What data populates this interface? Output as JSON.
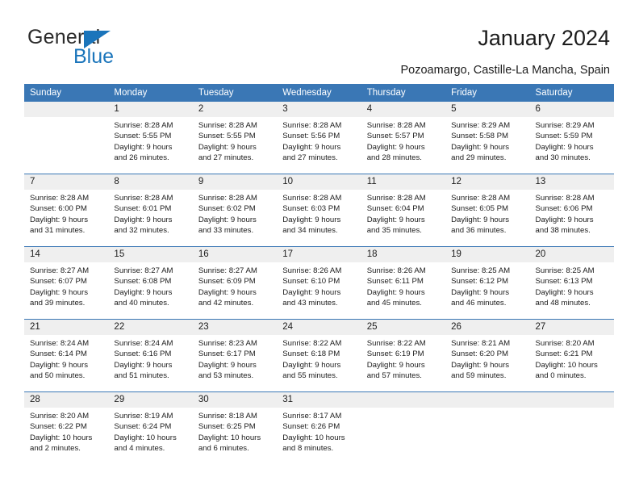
{
  "brand": {
    "name_part1": "General",
    "name_part2": "Blue"
  },
  "header": {
    "title": "January 2024",
    "subtitle": "Pozoamargo, Castille-La Mancha, Spain"
  },
  "colors": {
    "header_blue": "#3a77b5",
    "brand_blue": "#1b75bb",
    "daynum_bg": "#efefef",
    "text": "#1c1c1c"
  },
  "weekdays": [
    "Sunday",
    "Monday",
    "Tuesday",
    "Wednesday",
    "Thursday",
    "Friday",
    "Saturday"
  ],
  "labels": {
    "sunrise_prefix": "Sunrise:",
    "sunset_prefix": "Sunset:",
    "daylight_prefix": "Daylight:"
  },
  "weeks": [
    [
      {
        "day": "",
        "blank": true,
        "line1": "",
        "line2": "",
        "line3": "",
        "line4": ""
      },
      {
        "day": "1",
        "line1": "Sunrise: 8:28 AM",
        "line2": "Sunset: 5:55 PM",
        "line3": "Daylight: 9 hours",
        "line4": "and 26 minutes."
      },
      {
        "day": "2",
        "line1": "Sunrise: 8:28 AM",
        "line2": "Sunset: 5:55 PM",
        "line3": "Daylight: 9 hours",
        "line4": "and 27 minutes."
      },
      {
        "day": "3",
        "line1": "Sunrise: 8:28 AM",
        "line2": "Sunset: 5:56 PM",
        "line3": "Daylight: 9 hours",
        "line4": "and 27 minutes."
      },
      {
        "day": "4",
        "line1": "Sunrise: 8:28 AM",
        "line2": "Sunset: 5:57 PM",
        "line3": "Daylight: 9 hours",
        "line4": "and 28 minutes."
      },
      {
        "day": "5",
        "line1": "Sunrise: 8:29 AM",
        "line2": "Sunset: 5:58 PM",
        "line3": "Daylight: 9 hours",
        "line4": "and 29 minutes."
      },
      {
        "day": "6",
        "line1": "Sunrise: 8:29 AM",
        "line2": "Sunset: 5:59 PM",
        "line3": "Daylight: 9 hours",
        "line4": "and 30 minutes."
      }
    ],
    [
      {
        "day": "7",
        "line1": "Sunrise: 8:28 AM",
        "line2": "Sunset: 6:00 PM",
        "line3": "Daylight: 9 hours",
        "line4": "and 31 minutes."
      },
      {
        "day": "8",
        "line1": "Sunrise: 8:28 AM",
        "line2": "Sunset: 6:01 PM",
        "line3": "Daylight: 9 hours",
        "line4": "and 32 minutes."
      },
      {
        "day": "9",
        "line1": "Sunrise: 8:28 AM",
        "line2": "Sunset: 6:02 PM",
        "line3": "Daylight: 9 hours",
        "line4": "and 33 minutes."
      },
      {
        "day": "10",
        "line1": "Sunrise: 8:28 AM",
        "line2": "Sunset: 6:03 PM",
        "line3": "Daylight: 9 hours",
        "line4": "and 34 minutes."
      },
      {
        "day": "11",
        "line1": "Sunrise: 8:28 AM",
        "line2": "Sunset: 6:04 PM",
        "line3": "Daylight: 9 hours",
        "line4": "and 35 minutes."
      },
      {
        "day": "12",
        "line1": "Sunrise: 8:28 AM",
        "line2": "Sunset: 6:05 PM",
        "line3": "Daylight: 9 hours",
        "line4": "and 36 minutes."
      },
      {
        "day": "13",
        "line1": "Sunrise: 8:28 AM",
        "line2": "Sunset: 6:06 PM",
        "line3": "Daylight: 9 hours",
        "line4": "and 38 minutes."
      }
    ],
    [
      {
        "day": "14",
        "line1": "Sunrise: 8:27 AM",
        "line2": "Sunset: 6:07 PM",
        "line3": "Daylight: 9 hours",
        "line4": "and 39 minutes."
      },
      {
        "day": "15",
        "line1": "Sunrise: 8:27 AM",
        "line2": "Sunset: 6:08 PM",
        "line3": "Daylight: 9 hours",
        "line4": "and 40 minutes."
      },
      {
        "day": "16",
        "line1": "Sunrise: 8:27 AM",
        "line2": "Sunset: 6:09 PM",
        "line3": "Daylight: 9 hours",
        "line4": "and 42 minutes."
      },
      {
        "day": "17",
        "line1": "Sunrise: 8:26 AM",
        "line2": "Sunset: 6:10 PM",
        "line3": "Daylight: 9 hours",
        "line4": "and 43 minutes."
      },
      {
        "day": "18",
        "line1": "Sunrise: 8:26 AM",
        "line2": "Sunset: 6:11 PM",
        "line3": "Daylight: 9 hours",
        "line4": "and 45 minutes."
      },
      {
        "day": "19",
        "line1": "Sunrise: 8:25 AM",
        "line2": "Sunset: 6:12 PM",
        "line3": "Daylight: 9 hours",
        "line4": "and 46 minutes."
      },
      {
        "day": "20",
        "line1": "Sunrise: 8:25 AM",
        "line2": "Sunset: 6:13 PM",
        "line3": "Daylight: 9 hours",
        "line4": "and 48 minutes."
      }
    ],
    [
      {
        "day": "21",
        "line1": "Sunrise: 8:24 AM",
        "line2": "Sunset: 6:14 PM",
        "line3": "Daylight: 9 hours",
        "line4": "and 50 minutes."
      },
      {
        "day": "22",
        "line1": "Sunrise: 8:24 AM",
        "line2": "Sunset: 6:16 PM",
        "line3": "Daylight: 9 hours",
        "line4": "and 51 minutes."
      },
      {
        "day": "23",
        "line1": "Sunrise: 8:23 AM",
        "line2": "Sunset: 6:17 PM",
        "line3": "Daylight: 9 hours",
        "line4": "and 53 minutes."
      },
      {
        "day": "24",
        "line1": "Sunrise: 8:22 AM",
        "line2": "Sunset: 6:18 PM",
        "line3": "Daylight: 9 hours",
        "line4": "and 55 minutes."
      },
      {
        "day": "25",
        "line1": "Sunrise: 8:22 AM",
        "line2": "Sunset: 6:19 PM",
        "line3": "Daylight: 9 hours",
        "line4": "and 57 minutes."
      },
      {
        "day": "26",
        "line1": "Sunrise: 8:21 AM",
        "line2": "Sunset: 6:20 PM",
        "line3": "Daylight: 9 hours",
        "line4": "and 59 minutes."
      },
      {
        "day": "27",
        "line1": "Sunrise: 8:20 AM",
        "line2": "Sunset: 6:21 PM",
        "line3": "Daylight: 10 hours",
        "line4": "and 0 minutes."
      }
    ],
    [
      {
        "day": "28",
        "line1": "Sunrise: 8:20 AM",
        "line2": "Sunset: 6:22 PM",
        "line3": "Daylight: 10 hours",
        "line4": "and 2 minutes."
      },
      {
        "day": "29",
        "line1": "Sunrise: 8:19 AM",
        "line2": "Sunset: 6:24 PM",
        "line3": "Daylight: 10 hours",
        "line4": "and 4 minutes."
      },
      {
        "day": "30",
        "line1": "Sunrise: 8:18 AM",
        "line2": "Sunset: 6:25 PM",
        "line3": "Daylight: 10 hours",
        "line4": "and 6 minutes."
      },
      {
        "day": "31",
        "line1": "Sunrise: 8:17 AM",
        "line2": "Sunset: 6:26 PM",
        "line3": "Daylight: 10 hours",
        "line4": "and 8 minutes."
      },
      {
        "day": "",
        "blank": true,
        "line1": "",
        "line2": "",
        "line3": "",
        "line4": ""
      },
      {
        "day": "",
        "blank": true,
        "line1": "",
        "line2": "",
        "line3": "",
        "line4": ""
      },
      {
        "day": "",
        "blank": true,
        "line1": "",
        "line2": "",
        "line3": "",
        "line4": ""
      }
    ]
  ]
}
